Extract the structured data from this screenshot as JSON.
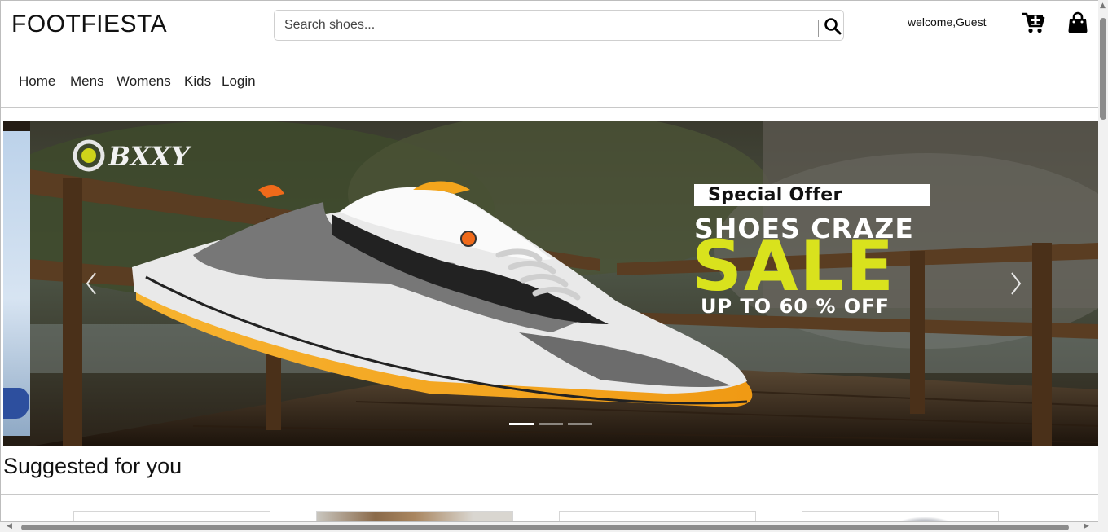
{
  "header": {
    "brand": "FOOTFIESTA",
    "search_placeholder": "Search shoes...",
    "welcome": "welcome,Guest",
    "icons": [
      "search-icon",
      "cart-plus-icon",
      "shopping-bag-icon"
    ]
  },
  "nav": {
    "items": [
      {
        "label": "Home"
      },
      {
        "label": "Mens"
      },
      {
        "label": "Womens"
      },
      {
        "label": "Kids"
      },
      {
        "label": "Login"
      }
    ]
  },
  "carousel": {
    "banner": {
      "brand_logo": "BXXY",
      "tag": "Special Offer",
      "headline": "SHOES CRAZE",
      "sale": "SALE",
      "discount": "UP TO 60 % OFF"
    },
    "slide_count": 3,
    "active_slide": 1,
    "colors": {
      "sale": "#d9e21d",
      "sole": "#f4a51c"
    }
  },
  "suggested": {
    "title": "Suggested for you",
    "card_count": 4
  }
}
